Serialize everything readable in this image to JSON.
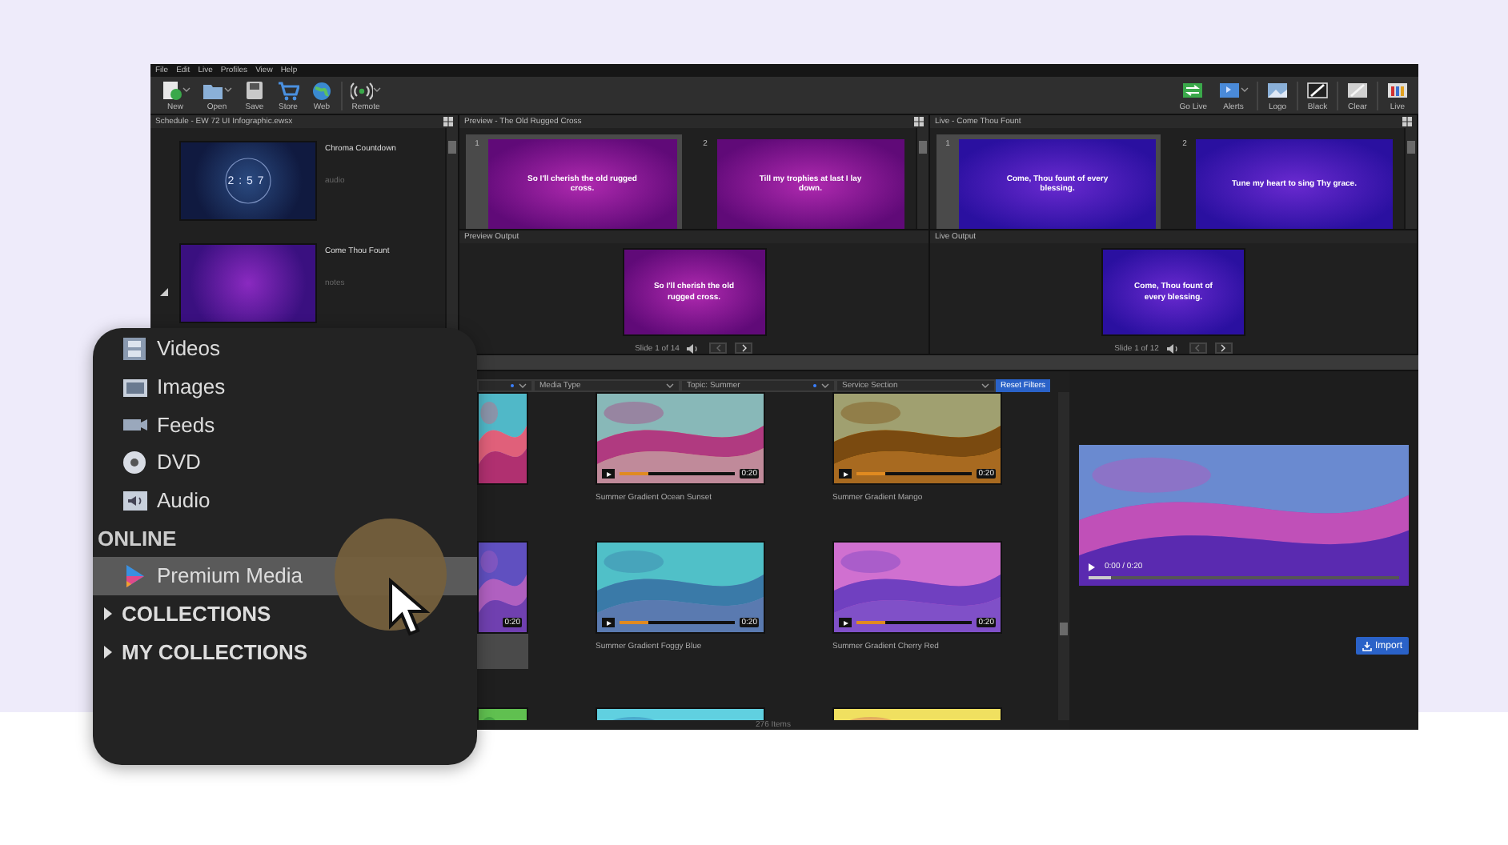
{
  "menu": [
    "File",
    "Edit",
    "Live",
    "Profiles",
    "View",
    "Help"
  ],
  "toolbar": {
    "left": [
      {
        "label": "New",
        "kind": "new",
        "dropdown": true
      },
      {
        "label": "Open",
        "kind": "open",
        "dropdown": true
      },
      {
        "label": "Save",
        "kind": "save",
        "dropdown": false
      },
      {
        "label": "Store",
        "kind": "store",
        "dropdown": false
      },
      {
        "label": "Web",
        "kind": "web",
        "dropdown": false
      },
      {
        "label": "Remote",
        "kind": "remote",
        "dropdown": true
      }
    ],
    "right": [
      {
        "label": "Go Live",
        "kind": "golive",
        "dropdown": false
      },
      {
        "label": "Alerts",
        "kind": "alerts",
        "dropdown": true
      },
      {
        "label": "Logo",
        "kind": "logo",
        "dropdown": false
      },
      {
        "label": "Black",
        "kind": "black",
        "dropdown": false
      },
      {
        "label": "Clear",
        "kind": "clear",
        "dropdown": false
      },
      {
        "label": "Live",
        "kind": "live",
        "dropdown": false
      }
    ]
  },
  "schedule": {
    "title": "Schedule - EW 72 UI Infographic.ewsx",
    "items": [
      {
        "title": "Chroma Countdown",
        "note": "audio",
        "kind": "countdown",
        "countdown": "2:57"
      },
      {
        "title": "Come Thou Fount",
        "note": "notes",
        "kind": "song"
      }
    ]
  },
  "preview": {
    "title": "Preview - The Old Rugged Cross",
    "slides": [
      {
        "number": "1",
        "text": "So I'll cherish the old rugged cross.",
        "selected": true
      },
      {
        "number": "2",
        "text": "Till my trophies at last I lay down.",
        "selected": false
      }
    ],
    "output_label": "Preview Output",
    "output_text": "So I'll cherish the old rugged cross.",
    "counter": "Slide 1 of 14"
  },
  "live": {
    "title": "Live - Come Thou Fount",
    "slides": [
      {
        "number": "1",
        "text": "Come, Thou fount of every blessing.",
        "selected": true
      },
      {
        "number": "2",
        "text": "Tune my heart to sing Thy grace.",
        "selected": false
      }
    ],
    "output_label": "Live Output",
    "output_text": "Come, Thou fount of every blessing.",
    "counter": "Slide 1 of 12"
  },
  "filters": [
    {
      "active": true
    },
    {
      "label": "Media Type",
      "active": false
    },
    {
      "label": "Topic: Summer",
      "active": true
    },
    {
      "label": "Service Section",
      "active": false
    }
  ],
  "reset_button": "Reset Filters",
  "media": [
    {
      "kind": "cut",
      "selected": false
    },
    {
      "kind": "full",
      "title": "Summer Gradient Ocean Sunset",
      "duration": "0:20",
      "level": 0.25,
      "selected": false
    },
    {
      "kind": "full",
      "title": "Summer Gradient Mango",
      "duration": "0:20",
      "level": 0.25,
      "selected": false
    },
    {
      "kind": "cut",
      "duration": "0:20",
      "selected": true
    },
    {
      "kind": "full",
      "title": "Summer Gradient Foggy Blue",
      "duration": "0:20",
      "level": 0.25,
      "selected": false
    },
    {
      "kind": "full",
      "title": "Summer Gradient Cherry Red",
      "duration": "0:20",
      "level": 0.25,
      "selected": false
    },
    {
      "kind": "cut",
      "selected": false
    },
    {
      "kind": "full",
      "selected": false
    },
    {
      "kind": "full",
      "selected": false
    }
  ],
  "status": "276 Items",
  "player": {
    "time": "0:00 / 0:20",
    "level": 0.07
  },
  "import_button": "Import",
  "library": {
    "items": [
      {
        "label": "Videos",
        "kind": "videos"
      },
      {
        "label": "Images",
        "kind": "images"
      },
      {
        "label": "Feeds",
        "kind": "feeds"
      },
      {
        "label": "DVD",
        "kind": "dvd"
      },
      {
        "label": "Audio",
        "kind": "audio"
      }
    ],
    "online_heading": "ONLINE",
    "online_items": [
      {
        "label": "Premium Media",
        "selected": true
      }
    ],
    "groups": [
      {
        "label": "COLLECTIONS",
        "expanded": false
      },
      {
        "label": "MY COLLECTIONS",
        "expanded": false
      }
    ]
  }
}
